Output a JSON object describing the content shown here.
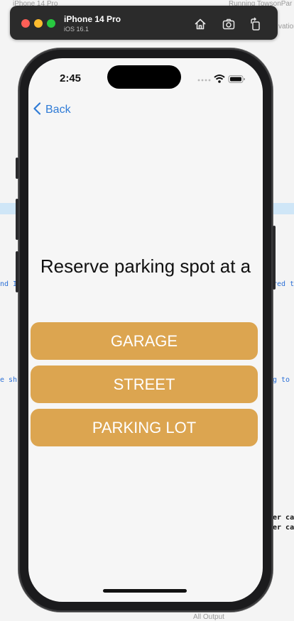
{
  "simulator": {
    "device": "iPhone 14 Pro",
    "os": "iOS 16.1",
    "home_icon": "home-icon",
    "screenshot_icon": "camera-icon",
    "rotate_icon": "rotate-icon"
  },
  "background": {
    "top_left": "iPhone 14 Pro",
    "top_right": "Running TowsonPar",
    "right_snippet": "vation",
    "mid_left": "nd I",
    "mid_right": "red t",
    "lower_left": "e sh",
    "lower_right": "g to",
    "console_1": "er ca",
    "console_2": "er ca",
    "bottom": "All Output"
  },
  "status_bar": {
    "time": "2:45"
  },
  "nav": {
    "back_label": "Back"
  },
  "main": {
    "title": "Reserve parking spot at a",
    "options": [
      {
        "label": "GARAGE"
      },
      {
        "label": "STREET"
      },
      {
        "label": "PARKING LOT"
      }
    ]
  },
  "colors": {
    "button": "#dca550",
    "link": "#2f7bd6",
    "screen_bg": "#f6f6f6"
  }
}
